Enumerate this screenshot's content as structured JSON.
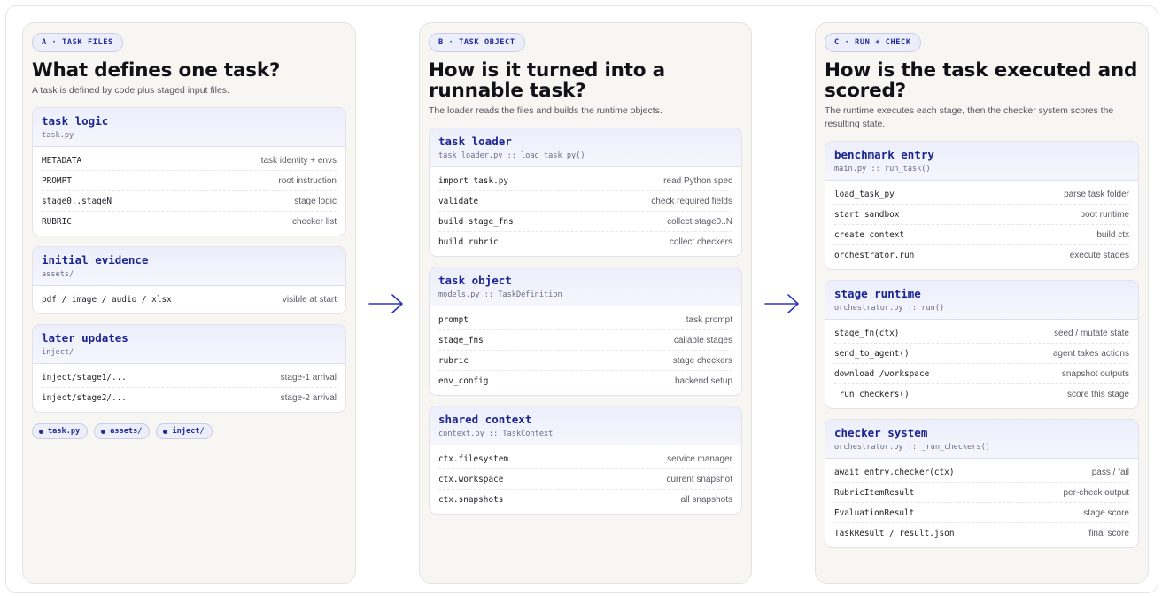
{
  "panels": [
    {
      "tag": "A · TASK FILES",
      "title": "What defines one task?",
      "subtitle": "A task is defined by code plus staged input files.",
      "cards": [
        {
          "title": "task logic",
          "file": "task.py",
          "rows": [
            {
              "key": "METADATA",
              "value": "task identity + envs"
            },
            {
              "key": "PROMPT",
              "value": "root instruction"
            },
            {
              "key": "stage0..stageN",
              "value": "stage logic"
            },
            {
              "key": "RUBRIC",
              "value": "checker list"
            }
          ]
        },
        {
          "title": "initial evidence",
          "file": "assets/",
          "rows": [
            {
              "key": "pdf / image / audio / xlsx",
              "value": "visible at start"
            }
          ]
        },
        {
          "title": "later updates",
          "file": "inject/",
          "rows": [
            {
              "key": "inject/stage1/...",
              "value": "stage-1 arrival"
            },
            {
              "key": "inject/stage2/...",
              "value": "stage-2 arrival"
            }
          ]
        }
      ],
      "chips": [
        "task.py",
        "assets/",
        "inject/"
      ]
    },
    {
      "tag": "B · TASK OBJECT",
      "title": "How is it turned into a runnable task?",
      "subtitle": "The loader reads the files and builds the runtime objects.",
      "cards": [
        {
          "title": "task loader",
          "file": "task_loader.py :: load_task_py()",
          "rows": [
            {
              "key": "import task.py",
              "value": "read Python spec"
            },
            {
              "key": "validate",
              "value": "check required fields"
            },
            {
              "key": "build stage_fns",
              "value": "collect stage0..N"
            },
            {
              "key": "build rubric",
              "value": "collect checkers"
            }
          ]
        },
        {
          "title": "task object",
          "file": "models.py :: TaskDefinition",
          "rows": [
            {
              "key": "prompt",
              "value": "task prompt"
            },
            {
              "key": "stage_fns",
              "value": "callable stages"
            },
            {
              "key": "rubric",
              "value": "stage checkers"
            },
            {
              "key": "env_config",
              "value": "backend setup"
            }
          ]
        },
        {
          "title": "shared context",
          "file": "context.py :: TaskContext",
          "rows": [
            {
              "key": "ctx.filesystem",
              "value": "service manager"
            },
            {
              "key": "ctx.workspace",
              "value": "current snapshot"
            },
            {
              "key": "ctx.snapshots",
              "value": "all snapshots"
            }
          ]
        }
      ]
    },
    {
      "tag": "C · RUN + CHECK",
      "title": "How is the task executed and scored?",
      "subtitle": "The runtime executes each stage, then the checker system scores the resulting state.",
      "cards": [
        {
          "title": "benchmark entry",
          "file": "main.py :: run_task()",
          "rows": [
            {
              "key": "load_task_py",
              "value": "parse task folder"
            },
            {
              "key": "start sandbox",
              "value": "boot runtime"
            },
            {
              "key": "create context",
              "value": "build ctx"
            },
            {
              "key": "orchestrator.run",
              "value": "execute stages"
            }
          ]
        },
        {
          "title": "stage runtime",
          "file": "orchestrator.py :: run()",
          "rows": [
            {
              "key": "stage_fn(ctx)",
              "value": "seed / mutate state"
            },
            {
              "key": "send_to_agent()",
              "value": "agent takes actions"
            },
            {
              "key": "download /workspace",
              "value": "snapshot outputs"
            },
            {
              "key": "_run_checkers()",
              "value": "score this stage"
            }
          ]
        },
        {
          "title": "checker system",
          "file": "orchestrator.py :: _run_checkers()",
          "rows": [
            {
              "key": "await entry.checker(ctx)",
              "value": "pass / fail"
            },
            {
              "key": "RubricItemResult",
              "value": "per-check output"
            },
            {
              "key": "EvaluationResult",
              "value": "stage score"
            },
            {
              "key": "TaskResult / result.json",
              "value": "final score"
            }
          ]
        }
      ]
    }
  ],
  "arrow_color": "#2b37b8",
  "accent_color": "#1a2492"
}
